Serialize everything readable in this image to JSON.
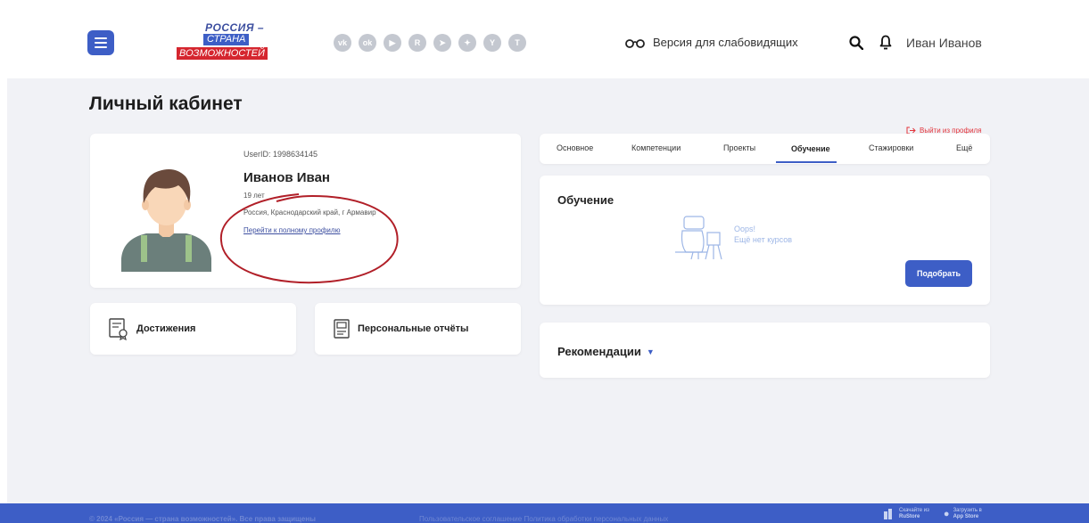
{
  "header": {
    "logo": {
      "line1": "РОССИЯ –",
      "line2": "СТРАНА",
      "line3": "ВОЗМОЖНОСТЕЙ"
    },
    "socials": [
      {
        "icon": "vk-icon",
        "glyph": "vk"
      },
      {
        "icon": "odnoklassniki-icon",
        "glyph": "ok"
      },
      {
        "icon": "youtube-icon",
        "glyph": "▶"
      },
      {
        "icon": "rutube-icon",
        "glyph": "R"
      },
      {
        "icon": "telegram-icon",
        "glyph": "➤"
      },
      {
        "icon": "dzen-icon",
        "glyph": "✦"
      },
      {
        "icon": "yappy-icon",
        "glyph": "Y"
      },
      {
        "icon": "tenchat-icon",
        "glyph": "T"
      }
    ],
    "vision_label": "Версия для слабовидящих",
    "user_name": "Иван Иванов"
  },
  "page": {
    "title": "Личный кабинет",
    "logout_label": "Выйти из профиля"
  },
  "profile": {
    "user_id": "UserID: 1998634145",
    "name": "Иванов Иван",
    "age": "19 лет",
    "location": "Россия, Краснодарский край, г Армавир",
    "full_profile_link": "Перейти к полному профилю"
  },
  "cards": {
    "achievements": "Достижения",
    "reports": "Персональные отчёты"
  },
  "tabs": [
    {
      "label": "Основное",
      "active": false
    },
    {
      "label": "Компетенции",
      "active": false
    },
    {
      "label": "Проекты",
      "active": false
    },
    {
      "label": "Обучение",
      "active": true
    },
    {
      "label": "Стажировки",
      "active": false
    },
    {
      "label": "Ещё",
      "active": false
    }
  ],
  "learning": {
    "title": "Обучение",
    "oops": "Oops!",
    "empty_text": "Ещё нет курсов",
    "pick_button": "Подобрать"
  },
  "recommendations": {
    "title": "Рекомендации"
  },
  "footer": {
    "copyright": "© 2024 «Россия — страна возможностей». Все права защищены",
    "links": "Пользовательское соглашение   Политика обработки персональных данных",
    "rustore_top": "Скачайте из",
    "rustore_bottom": "RuStore",
    "appstore_top": "Загрузить в",
    "appstore_bottom": "App Store"
  },
  "colors": {
    "accent": "#3d5ec6",
    "danger": "#e3343b",
    "background": "#f1f2f6"
  }
}
